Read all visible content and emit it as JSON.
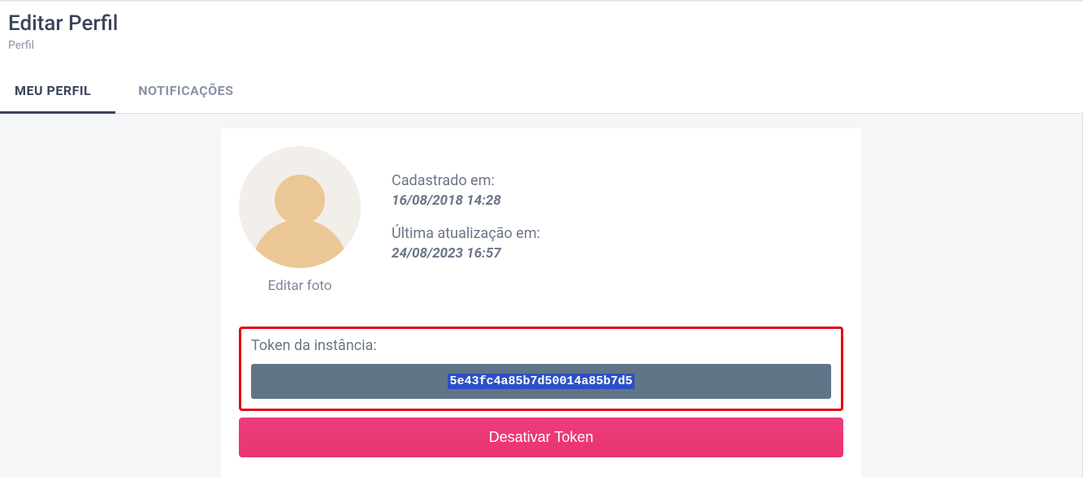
{
  "header": {
    "title": "Editar Perfil",
    "breadcrumb": "Perfil"
  },
  "tabs": {
    "my_profile": "MEU PERFIL",
    "notifications": "NOTIFICAÇÕES"
  },
  "profile": {
    "edit_photo": "Editar foto",
    "registered_label": "Cadastrado em:",
    "registered_value": "16/08/2018 14:28",
    "updated_label": "Última atualização em:",
    "updated_value": "24/08/2023 16:57"
  },
  "token": {
    "label": "Token da instância:",
    "value": "5e43fc4a85b7d50014a85b7d5",
    "deactivate_label": "Desativar Token"
  }
}
